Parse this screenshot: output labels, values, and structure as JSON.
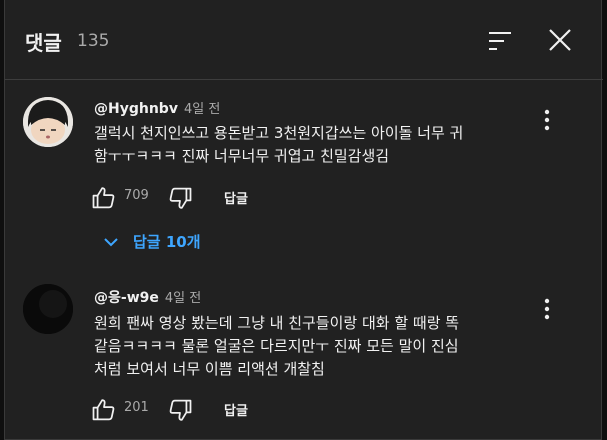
{
  "header": {
    "title": "댓글",
    "count": "135"
  },
  "comments": [
    {
      "author": "@Hyghnbv",
      "time": "4일 전",
      "lines": [
        "갤럭시 천지인쓰고 용돈받고 3천원지갑쓰는 아이돌 너무 귀",
        "함ㅜㅜㅋㅋㅋ 진짜 너무너무 귀엽고 친밀감생김"
      ],
      "likes": "709",
      "reply_label": "답글",
      "replies_label": "답글 10개"
    },
    {
      "author": "@응-w9e",
      "time": "4일 전",
      "lines": [
        "원희 팬싸 영상 봤는데 그냥 내 친구들이랑 대화 할 때랑 똑",
        "같음ㅋㅋㅋㅋ 물론 얼굴은 다르지만ㅜ 진짜 모든 말이 진심",
        "처럼 보여서 너무 이쁨 리액션 개찰침"
      ],
      "likes": "201",
      "reply_label": "답글"
    }
  ],
  "colors": {
    "background": "#212121",
    "link": "#3ea6ff",
    "muted": "#aaaaaa"
  },
  "icons": [
    "sort-icon",
    "close-icon",
    "more-vert-icon",
    "thumb-up-icon",
    "thumb-down-icon",
    "chevron-down-icon"
  ]
}
